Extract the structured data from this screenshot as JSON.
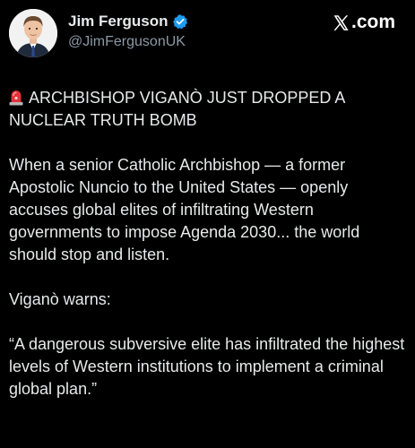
{
  "header": {
    "display_name": "Jim Ferguson",
    "handle": "@JimFergusonUK",
    "brand_label": ".com",
    "verified_icon": "verified-badge-icon",
    "brand_icon": "x-logo-icon"
  },
  "tweet": {
    "headline_icon": "siren-icon",
    "headline": "ARCHBISHOP VIGANÒ JUST DROPPED A NUCLEAR TRUTH BOMB",
    "paragraph_1": "When a senior Catholic Archbishop — a former Apostolic Nuncio to the United States — openly accuses global elites of infiltrating Western governments to impose Agenda 2030... the world should stop and listen.",
    "paragraph_2": "Viganò warns:",
    "paragraph_3": "“A dangerous subversive elite has infiltrated the highest levels of Western institutions to implement a criminal global plan.”"
  },
  "colors": {
    "background": "#000000",
    "text_primary": "#e7e9ea",
    "text_secondary": "#8b98a5",
    "verified_blue": "#1d9bf0",
    "siren_red": "#e0323a"
  }
}
